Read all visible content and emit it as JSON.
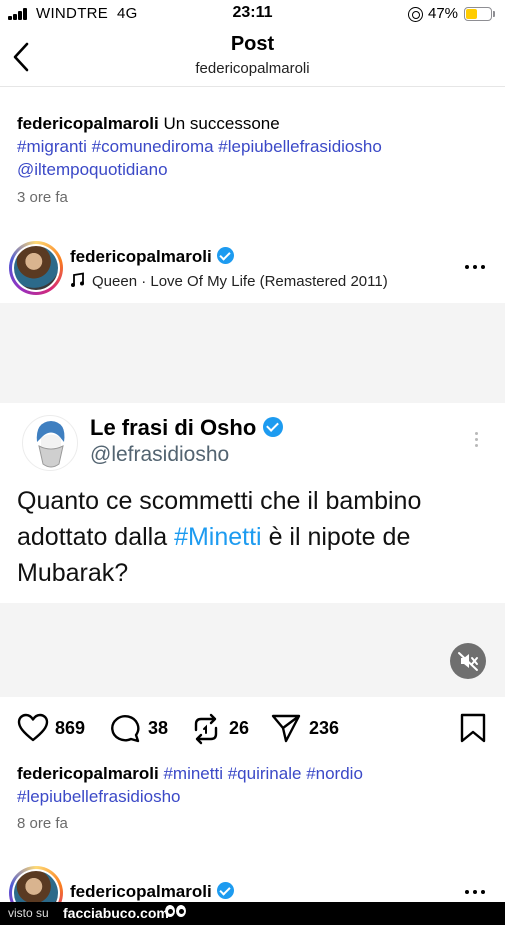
{
  "status_bar": {
    "carrier": "WINDTRE",
    "network": "4G",
    "time": "23:11",
    "battery_percent": "47%",
    "battery_level": 0.47,
    "battery_color": "#ffcc00"
  },
  "header": {
    "title": "Post",
    "subtitle": "federicopalmaroli"
  },
  "previous_post": {
    "user": "federicopalmaroli",
    "caption_text": "Un successone",
    "hashtags": [
      "#migranti",
      "#comunediroma",
      "#lepiubellefrasidiosho"
    ],
    "mention": "@iltempoquotidiano",
    "time": "3 ore fa"
  },
  "post": {
    "user": "federicopalmaroli",
    "verified": true,
    "music_icon": "music-note-icon",
    "music": "Queen · Love Of My Life (Remastered 2011)",
    "tweet": {
      "name": "Le frasi di Osho",
      "handle": "@lefrasidiosho",
      "text_before": "Quanto ce scommetti che il bambino adottato dalla ",
      "hashtag": "#Minetti",
      "text_after": " è il nipote de Mubarak?"
    },
    "actions": {
      "likes": "869",
      "comments": "38",
      "reposts": "26",
      "shares": "236"
    },
    "caption_user": "federicopalmaroli",
    "hashtags": [
      "#minetti",
      "#quirinale",
      "#nordio",
      "#lepiubellefrasidiosho"
    ],
    "time": "8 ore fa"
  },
  "next_post": {
    "user": "federicopalmaroli"
  },
  "watermark": {
    "prefix": "visto su",
    "site": "facciabuco.com"
  },
  "colors": {
    "hashtag": "#3b49c7",
    "tweet_hashtag": "#1d9bf0",
    "verified": "#1d9bf0"
  }
}
